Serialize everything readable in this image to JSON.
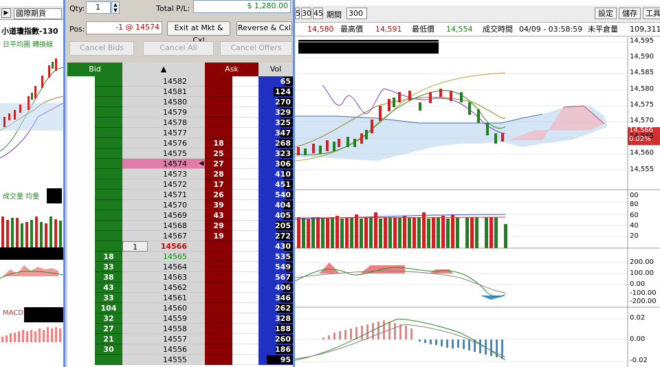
{
  "left": {
    "category": "國際期貨",
    "title": "小道瓊指數-130",
    "sub": "日平均圖 轉換線",
    "vol_title": "成交量 均量",
    "macd_title": "MACD"
  },
  "dom": {
    "qty_label": "Qty:",
    "qty_value": "1",
    "pl_label": "Total P/L:",
    "pl_value": "$ 1,280.00",
    "pos_label": "Pos:",
    "pos_value": "-1 @ 14574",
    "exit_btn": "Exit at Mkt & Cxl",
    "reverse_btn": "Reverse & Cxl",
    "cancel_bids": "Cancel Bids",
    "cancel_all": "Cancel All",
    "cancel_offers": "Cancel Offers",
    "hdr_bid": "Bid",
    "hdr_ask": "Ask",
    "hdr_vol": "Vol",
    "colors": {
      "bid": "#1b7a1b",
      "ask": "#8b0000",
      "vol": "#2030c0",
      "pos": "#e07ca8"
    },
    "ladder": [
      {
        "price": "14582",
        "bid": "",
        "ask": "",
        "vol": "65",
        "volfrac": 0.25
      },
      {
        "price": "14581",
        "bid": "",
        "ask": "",
        "vol": "124",
        "volfrac": 0.55
      },
      {
        "price": "14580",
        "bid": "",
        "ask": "",
        "vol": "270",
        "volfrac": 0.45
      },
      {
        "price": "14579",
        "bid": "",
        "ask": "",
        "vol": "329",
        "volfrac": 0.35
      },
      {
        "price": "14578",
        "bid": "",
        "ask": "",
        "vol": "325",
        "volfrac": 0.35
      },
      {
        "price": "14577",
        "bid": "",
        "ask": "",
        "vol": "347",
        "volfrac": 0.35
      },
      {
        "price": "14576",
        "bid": "",
        "ask": "18",
        "vol": "268",
        "volfrac": 0.45
      },
      {
        "price": "14575",
        "bid": "",
        "ask": "25",
        "vol": "323",
        "volfrac": 0.35
      },
      {
        "price": "14574",
        "bid": "",
        "ask": "27",
        "vol": "306",
        "volfrac": 0.4,
        "position": true
      },
      {
        "price": "14573",
        "bid": "",
        "ask": "28",
        "vol": "410",
        "volfrac": 0.3
      },
      {
        "price": "14572",
        "bid": "",
        "ask": "17",
        "vol": "451",
        "volfrac": 0.25
      },
      {
        "price": "14571",
        "bid": "",
        "ask": "26",
        "vol": "540",
        "volfrac": 0.2
      },
      {
        "price": "14570",
        "bid": "",
        "ask": "39",
        "vol": "404",
        "volfrac": 0.3
      },
      {
        "price": "14569",
        "bid": "",
        "ask": "43",
        "vol": "405",
        "volfrac": 0.3
      },
      {
        "price": "14568",
        "bid": "",
        "ask": "29",
        "vol": "205",
        "volfrac": 0.5
      },
      {
        "price": "14567",
        "bid": "",
        "ask": "19",
        "vol": "272",
        "volfrac": 0.45
      },
      {
        "price": "14566",
        "bid": "",
        "ask": "",
        "vol": "430",
        "volfrac": 0.25,
        "last": true,
        "working": "1"
      },
      {
        "price": "14565",
        "bid": "18",
        "ask": "",
        "vol": "535",
        "volfrac": 0.2,
        "green": true
      },
      {
        "price": "14564",
        "bid": "33",
        "ask": "",
        "vol": "549",
        "volfrac": 0.2
      },
      {
        "price": "14563",
        "bid": "38",
        "ask": "",
        "vol": "567",
        "volfrac": 0.15
      },
      {
        "price": "14562",
        "bid": "43",
        "ask": "",
        "vol": "406",
        "volfrac": 0.3
      },
      {
        "price": "14561",
        "bid": "33",
        "ask": "",
        "vol": "346",
        "volfrac": 0.35
      },
      {
        "price": "14560",
        "bid": "104",
        "ask": "",
        "vol": "262",
        "volfrac": 0.45
      },
      {
        "price": "14559",
        "bid": "32",
        "ask": "",
        "vol": "328",
        "volfrac": 0.35
      },
      {
        "price": "14558",
        "bid": "27",
        "ask": "",
        "vol": "188",
        "volfrac": 0.5
      },
      {
        "price": "14557",
        "bid": "21",
        "ask": "",
        "vol": "260",
        "volfrac": 0.45
      },
      {
        "price": "14556",
        "bid": "30",
        "ask": "",
        "vol": "186",
        "volfrac": 0.5
      },
      {
        "price": "14555",
        "bid": "",
        "ask": "",
        "vol": "95",
        "volfrac": 0.75
      }
    ]
  },
  "right": {
    "tab_5": "5",
    "tab_30": "30",
    "tab_45": "45",
    "period_label": "期間",
    "period_value": "300",
    "btn_settings": "設定",
    "btn_save": "儲存",
    "btn_tools": "工具",
    "quote_last": "14,580",
    "quote_high_label": "最高價",
    "quote_high": "14,591",
    "quote_low_label": "最低價",
    "quote_low": "14,554",
    "quote_time_label": "成交時間",
    "quote_time": "04/09 - 03:58:59",
    "quote_oi_label": "未平倉量",
    "quote_oi": "109,311",
    "price_axis": [
      "14,595",
      "14,590",
      "14,585",
      "14,580",
      "14,575",
      "14,570",
      "14,565",
      "14,560",
      "14,555"
    ],
    "last_price_tag": "14,566",
    "last_pct_tag": "0.02%",
    "vol_axis": [
      "00",
      "80",
      "60",
      "40",
      "20"
    ],
    "osc_axis": [
      "200.00",
      "100.00",
      "0.00",
      "-100.00",
      "-200.00"
    ],
    "macd_axis": [
      "0.02",
      "0.00",
      "-0.02"
    ]
  }
}
